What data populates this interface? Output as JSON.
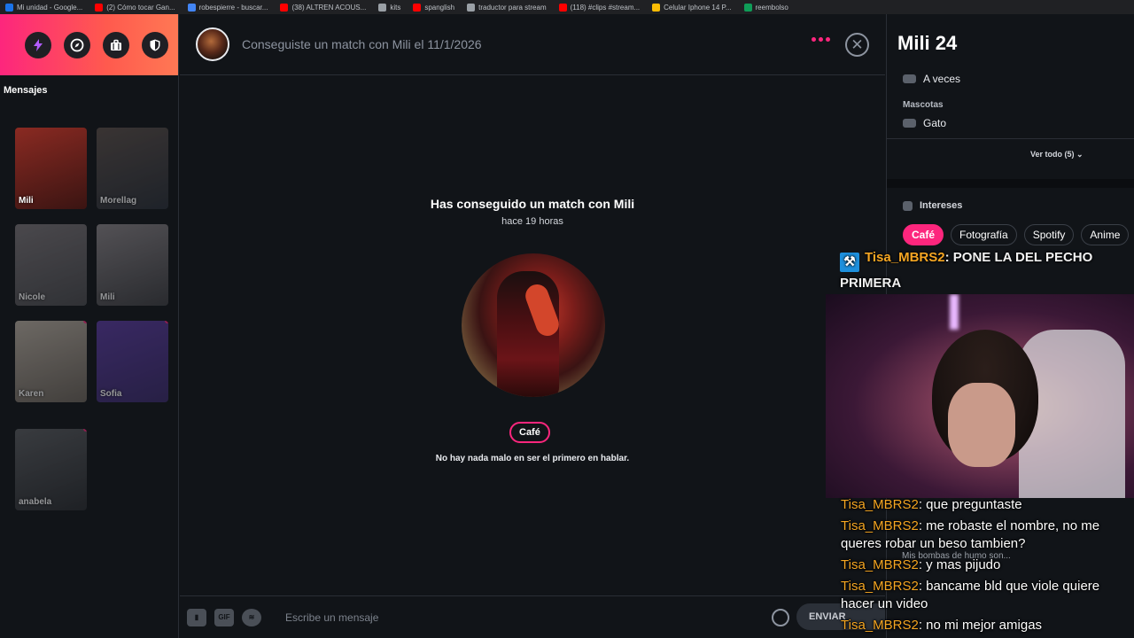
{
  "bookmarks": [
    {
      "label": "Mi unidad - Google...",
      "color": "#1a73e8"
    },
    {
      "label": "(2) Cómo tocar Gan...",
      "color": "#ff0000"
    },
    {
      "label": "robespierre - buscar...",
      "color": "#4285f4"
    },
    {
      "label": "(38) ALTREN ACOUS...",
      "color": "#ff0000"
    },
    {
      "label": "kits",
      "color": "#9aa0a6"
    },
    {
      "label": "spanglish",
      "color": "#ff0000"
    },
    {
      "label": "traductor para stream",
      "color": "#9aa0a6"
    },
    {
      "label": "(118) #clips #stream...",
      "color": "#ff0000"
    },
    {
      "label": "Celular Iphone 14 P...",
      "color": "#fbbc04"
    },
    {
      "label": "reembolso",
      "color": "#0f9d58"
    }
  ],
  "sidebar": {
    "header_icons": [
      "bolt-icon",
      "compass-icon",
      "briefcase-icon",
      "shield-icon"
    ],
    "messages_title": "Mensajes",
    "matches": [
      {
        "name": "Mili",
        "colors": [
          "#3a1412",
          "#8a2a22"
        ],
        "dim": false,
        "dot": false
      },
      {
        "name": "Morellag",
        "colors": [
          "#2a2f38",
          "#5b4f4a"
        ],
        "dim": true,
        "dot": false
      },
      {
        "name": "Nicole",
        "colors": [
          "#4a4a4e",
          "#7a7478"
        ],
        "dim": true,
        "dot": false
      },
      {
        "name": "Mili",
        "colors": [
          "#3e3e42",
          "#8a8488"
        ],
        "dim": true,
        "dot": false
      },
      {
        "name": "Karen",
        "colors": [
          "#6a625a",
          "#b8aea2"
        ],
        "dim": true,
        "dot": true
      },
      {
        "name": "Sofia",
        "colors": [
          "#3a2a6a",
          "#5a3aa0"
        ],
        "dim": true,
        "dot": true
      },
      {
        "name": "anabela",
        "colors": [
          "#2a2c30",
          "#5a5c60"
        ],
        "dim": true,
        "dot": true
      }
    ]
  },
  "conversation": {
    "header_text": "Conseguiste un match con Mili el 11/1/2026",
    "match_title_prefix": "Has conseguido un match con ",
    "match_name": "Mili",
    "match_time": "hace 19 horas",
    "interest": "Café",
    "tip": "No hay nada malo en ser el primero en hablar.",
    "composer_placeholder": "Escribe un mensaje",
    "gif_label": "GIF",
    "send_label": "ENVIAR"
  },
  "profile": {
    "name_age": "Mili 24",
    "drinking": "A veces",
    "pets_title": "Mascotas",
    "pets_value": "Gato",
    "see_all": "Ver todo (5)",
    "interests_title": "Intereses",
    "interests": [
      {
        "label": "Café",
        "active": true
      },
      {
        "label": "Fotografía",
        "active": false
      },
      {
        "label": "Spotify",
        "active": false
      },
      {
        "label": "Anime",
        "active": false
      }
    ]
  },
  "stream_overlay": {
    "top_message": {
      "user": "Tisa_MBRS2",
      "text": "PONE LA DEL PECHO PRIMERA"
    },
    "chat": [
      {
        "user": "Tisa_MBRS2",
        "text": "que preguntaste"
      },
      {
        "user": "Tisa_MBRS2",
        "text": "me robaste el nombre, no me queres robar un beso tambien?"
      },
      {
        "user": "Tisa_MBRS2",
        "text": "y mas pijudo"
      },
      {
        "user": "Tisa_MBRS2",
        "text": "bancame bld que viole quiere hacer un video"
      },
      {
        "user": "Tisa_MBRS2",
        "text": "no mi mejor amigas"
      }
    ],
    "ghost_text": "Mis bombas de humo son..."
  },
  "colors": {
    "brand_pink": "#fd267d",
    "brand_orange": "#ff7854",
    "chat_username": "#f5a623",
    "background": "#111418"
  }
}
